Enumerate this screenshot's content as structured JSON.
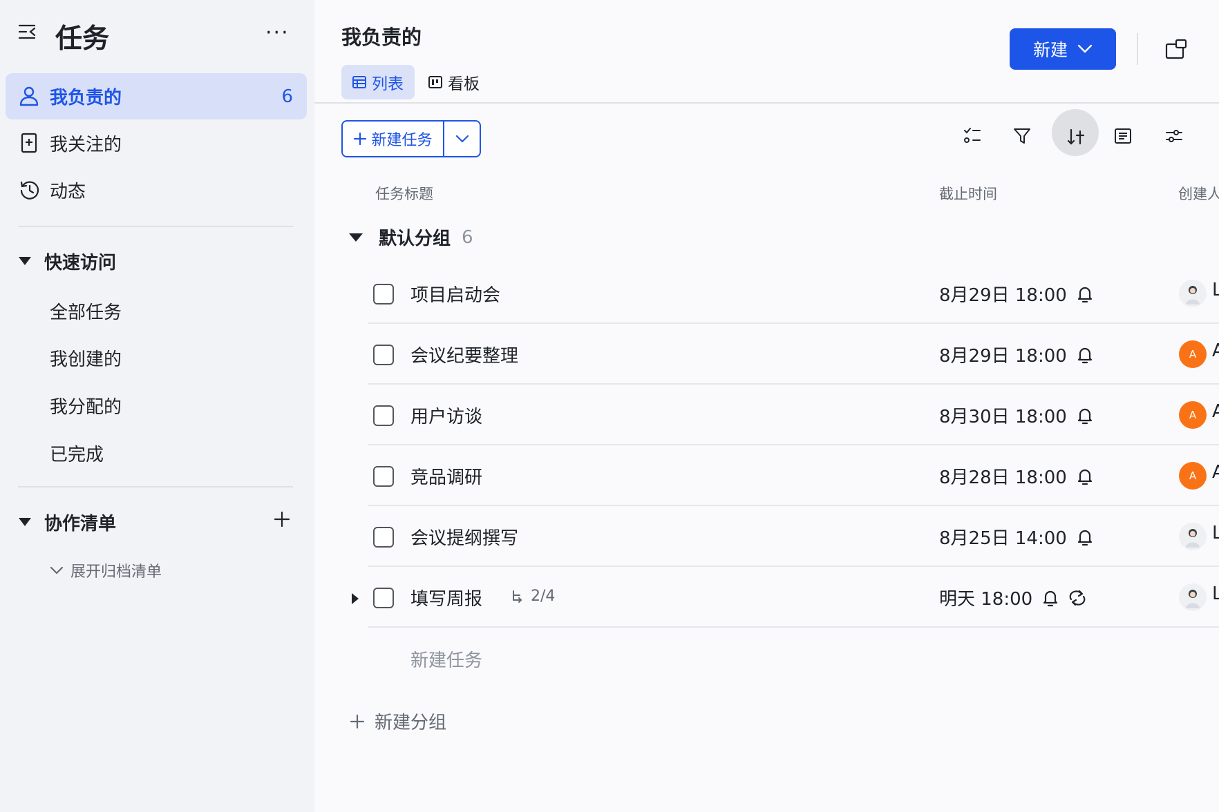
{
  "sidebar": {
    "title": "任务",
    "more_label": "···",
    "nav": [
      {
        "label": "我负责的",
        "count": "6",
        "active": true
      },
      {
        "label": "我关注的"
      },
      {
        "label": "动态"
      }
    ],
    "quick_access": {
      "label": "快速访问",
      "items": [
        "全部任务",
        "我创建的",
        "我分配的",
        "已完成"
      ]
    },
    "collab": {
      "label": "协作清单",
      "expand_archived": "展开归档清单"
    }
  },
  "header": {
    "title": "我负责的",
    "tabs": [
      {
        "label": "列表",
        "active": true
      },
      {
        "label": "看板"
      }
    ],
    "new_button": "新建"
  },
  "toolbar": {
    "new_task_button": "新建任务"
  },
  "table": {
    "columns": {
      "title": "任务标题",
      "due": "截止时间",
      "creator": "创建人"
    },
    "group": {
      "label": "默认分组",
      "count": "6"
    },
    "rows": [
      {
        "title": "项目启动会",
        "due": "8月29日 18:00",
        "creator_initial": "L",
        "avatar": "photo"
      },
      {
        "title": "会议纪要整理",
        "due": "8月29日 18:00",
        "creator_initial": "A",
        "avatar": "orange",
        "avatar_letter": "A"
      },
      {
        "title": "用户访谈",
        "due": "8月30日 18:00",
        "creator_initial": "A",
        "avatar": "orange",
        "avatar_letter": "A"
      },
      {
        "title": "竞品调研",
        "due": "8月28日 18:00",
        "creator_initial": "A",
        "avatar": "orange",
        "avatar_letter": "A"
      },
      {
        "title": "会议提纲撰写",
        "due": "8月25日 14:00",
        "creator_initial": "L",
        "avatar": "photo"
      },
      {
        "title": "填写周报",
        "due": "明天 18:00",
        "subtasks": "2/4",
        "creator_initial": "L",
        "avatar": "photo",
        "repeat": true
      }
    ],
    "new_task_inline": "新建任务",
    "new_group": "新建分组"
  },
  "colors": {
    "accent": "#1f55e6",
    "primary_button": "#1d55e8",
    "sidebar_bg": "#f2f3f7",
    "active_item_bg": "#d8dff9",
    "avatar_orange": "#f97316"
  },
  "icons": [
    "sidebar-collapse-icon",
    "more-icon",
    "user-icon",
    "bookmark-icon",
    "history-icon",
    "triangle-down-icon",
    "plus-icon",
    "chevron-down-icon",
    "table-icon",
    "kanban-icon",
    "window-icon",
    "checklist-icon",
    "filter-icon",
    "sort-icon",
    "list-detail-icon",
    "settings-sliders-icon",
    "bell-icon",
    "subtask-icon",
    "repeat-icon",
    "triangle-right-icon"
  ]
}
